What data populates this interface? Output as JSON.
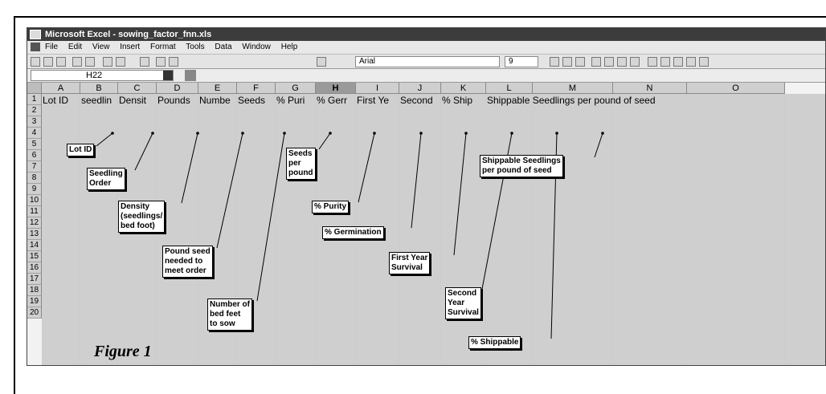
{
  "window": {
    "title": "Microsoft Excel - sowing_factor_fnn.xls"
  },
  "menu": [
    "File",
    "Edit",
    "View",
    "Insert",
    "Format",
    "Tools",
    "Data",
    "Window",
    "Help"
  ],
  "toolbar": {
    "font_name": "Arial",
    "font_size": "9"
  },
  "formula_bar": {
    "name_box": "H22",
    "selected_column": "H"
  },
  "columns": [
    "A",
    "B",
    "C",
    "D",
    "E",
    "F",
    "G",
    "H",
    "I",
    "J",
    "K",
    "L",
    "M",
    "N",
    "O"
  ],
  "rows": [
    "1",
    "2",
    "3",
    "4",
    "5",
    "6",
    "7",
    "8",
    "9",
    "10",
    "11",
    "12",
    "13",
    "14",
    "15",
    "16",
    "17",
    "18",
    "19",
    "20"
  ],
  "header_cells": {
    "A": "Lot ID",
    "B": "seedlin",
    "C": "Densit",
    "D": "Pounds",
    "E": "Numbe",
    "F": "Seeds",
    "G": "% Puri",
    "H": "% Gerr",
    "I": "First Ye",
    "J": "Second",
    "K": "% Ship",
    "L": "Shippable Seedlings per pound of seed"
  },
  "annotations": {
    "lot_id": "Lot ID",
    "seedling_order": "Seedling\nOrder",
    "density": "Density\n(seedlings/\nbed foot)",
    "pound_seed": "Pound seed\nneeded to\nmeet order",
    "bed_feet": "Number of\nbed feet\nto sow",
    "seeds_per_pound": "Seeds\nper\npound",
    "purity": "% Purity",
    "germination": "% Germination",
    "first_year": "First Year\nSurvival",
    "second_year": "Second\nYear\nSurvival",
    "shippable_per_pound": "Shippable Seedlings\nper pound of seed",
    "shippable": "% Shippable"
  },
  "figure_label": "Figure 1",
  "colors": {
    "titlebar": "#3c3c3c",
    "header_bg": "#cfcfcf",
    "selected_header": "#9a9a9a"
  }
}
